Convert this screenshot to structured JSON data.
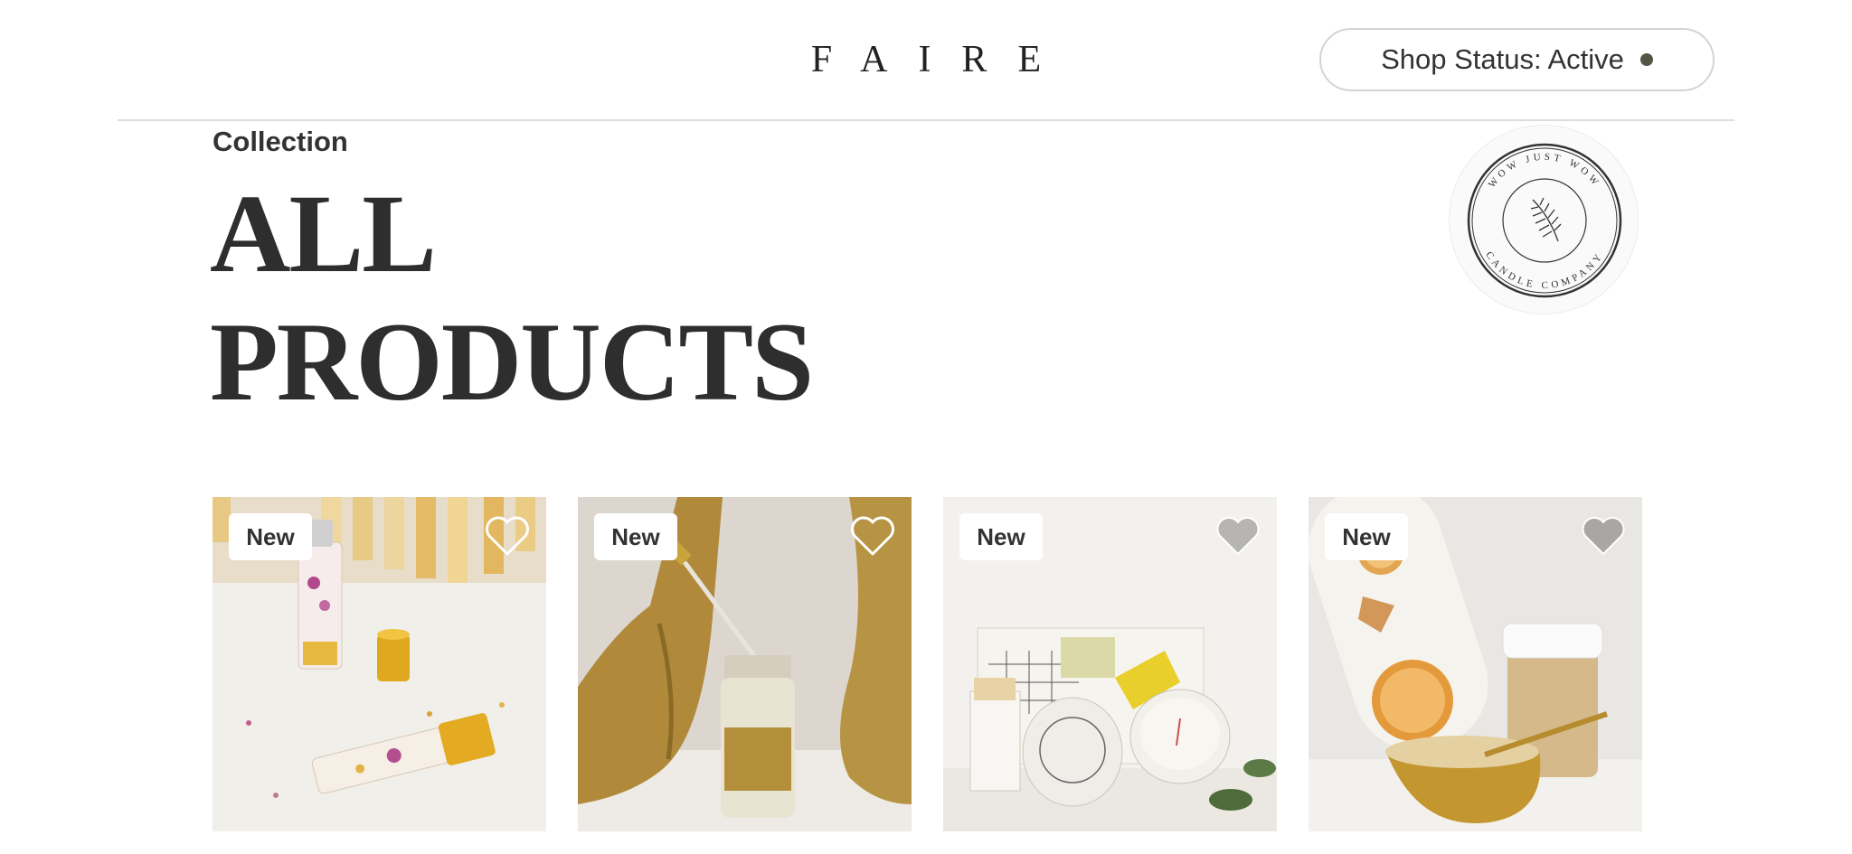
{
  "header": {
    "brand": "FAIRE",
    "shop_status_label": "Shop Status: Active",
    "status_color": "#555544"
  },
  "collection": {
    "eyebrow": "Collection",
    "title_line1": "ALL",
    "title_line2": "PRODUCTS"
  },
  "store_logo": {
    "top_text": "WOW JUST WOW",
    "bottom_text": "CANDLE COMPANY",
    "icon": "leaf-icon"
  },
  "products": [
    {
      "badge": "New",
      "image": "roll-on-perfume-bottles-with-dried-flowers",
      "favorite_icon": "heart-outline-icon"
    },
    {
      "badge": "New",
      "image": "dropper-serum-bottle-with-gold-hands",
      "favorite_icon": "heart-outline-icon"
    },
    {
      "badge": "New",
      "image": "candle-gift-set-with-box-and-matches",
      "favorite_icon": "heart-filled-icon"
    },
    {
      "badge": "New",
      "image": "sugar-scrub-jar-with-orange-slices",
      "favorite_icon": "heart-filled-icon"
    }
  ],
  "colors": {
    "text": "#333333",
    "accent_gold": "#c8a13a"
  }
}
